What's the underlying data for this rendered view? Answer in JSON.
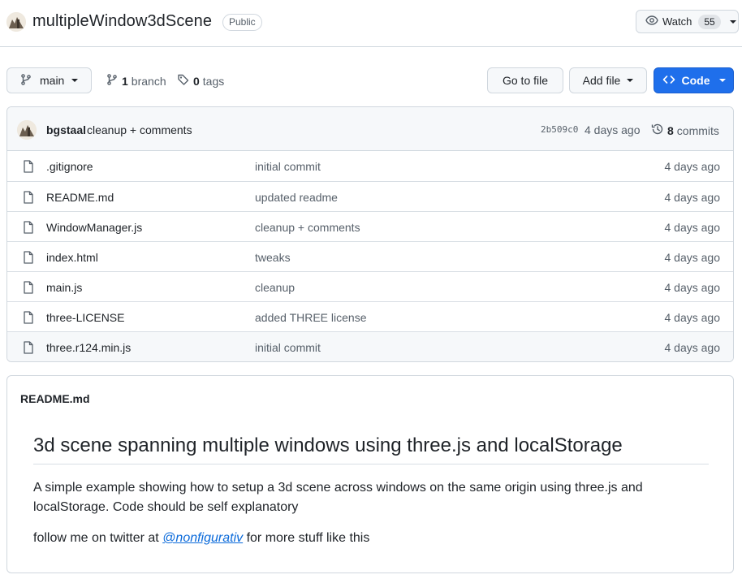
{
  "repo": {
    "name": "multipleWindow3dScene",
    "visibility": "Public",
    "watch_label": "Watch",
    "watch_count": "55"
  },
  "toolbar": {
    "branch": "main",
    "branch_count": "1",
    "branch_word": "branch",
    "tag_count": "0",
    "tag_word": "tags",
    "go_to_file": "Go to file",
    "add_file": "Add file",
    "code": "Code"
  },
  "latest_commit": {
    "author": "bgstaal",
    "message": "cleanup + comments",
    "sha": "2b509c0",
    "time": "4 days ago",
    "count": "8",
    "count_word": "commits"
  },
  "files": [
    {
      "name": ".gitignore",
      "commit": "initial commit",
      "age": "4 days ago"
    },
    {
      "name": "README.md",
      "commit": "updated readme",
      "age": "4 days ago"
    },
    {
      "name": "WindowManager.js",
      "commit": "cleanup + comments",
      "age": "4 days ago"
    },
    {
      "name": "index.html",
      "commit": "tweaks",
      "age": "4 days ago"
    },
    {
      "name": "main.js",
      "commit": "cleanup",
      "age": "4 days ago"
    },
    {
      "name": "three-LICENSE",
      "commit": "added THREE license",
      "age": "4 days ago"
    },
    {
      "name": "three.r124.min.js",
      "commit": "initial commit",
      "age": "4 days ago"
    }
  ],
  "readme": {
    "file_label": "README.md",
    "title": "3d scene spanning multiple windows using three.js and localStorage",
    "paragraph1": "A simple example showing how to setup a 3d scene across windows on the same origin using three.js and localStorage. Code should be self explanatory",
    "paragraph2_prefix": "follow me on twitter at ",
    "twitter_link": "@nonfigurativ",
    "paragraph2_suffix": " for more stuff like this"
  },
  "colors": {
    "accent": "#1f6feb",
    "link": "#0969da",
    "border": "#d0d7de",
    "muted_text": "#57606a"
  },
  "icons": [
    "owner-avatar-icon",
    "eye-icon",
    "git-branch-icon",
    "tag-icon",
    "code-brackets-icon",
    "history-icon",
    "file-icon"
  ]
}
